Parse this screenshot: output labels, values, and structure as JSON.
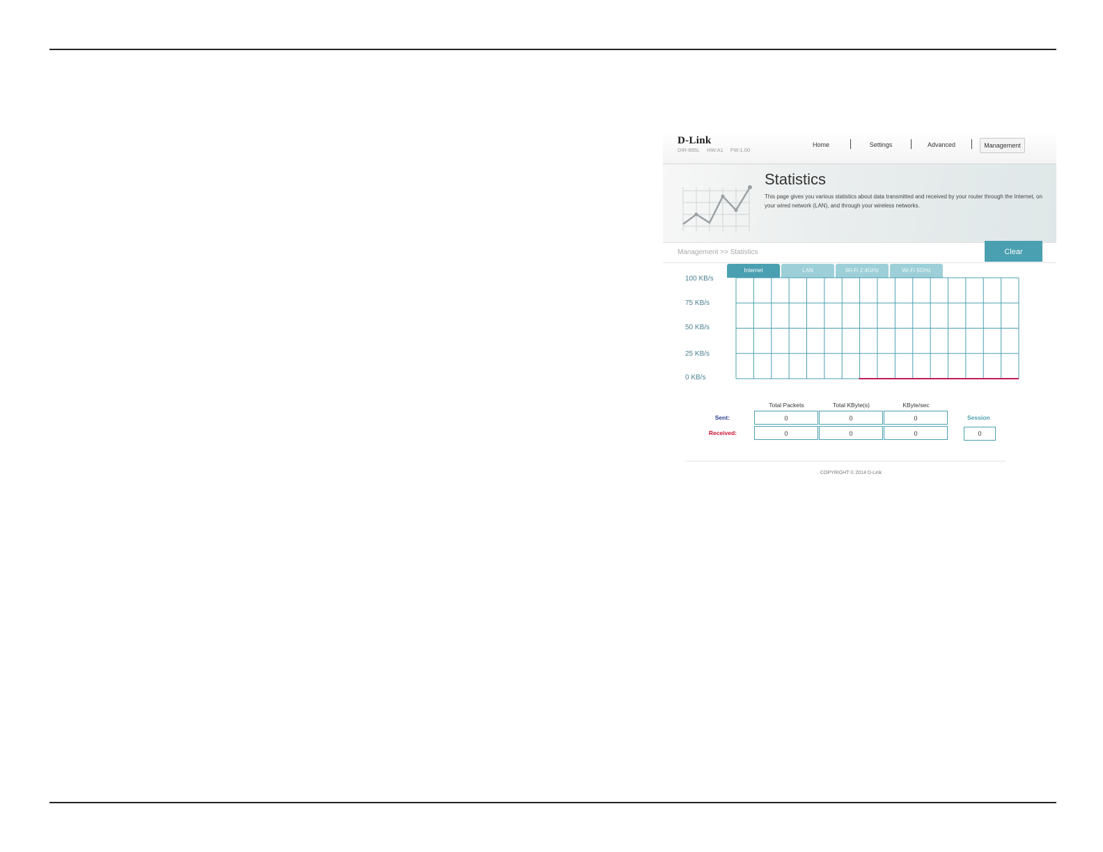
{
  "header": {
    "logo": "D-Link",
    "model": "DIR-885L",
    "hw": "HW:A1",
    "fw": "FW:1.00",
    "nav": [
      "Home",
      "Settings",
      "Advanced",
      "Management"
    ],
    "active_nav": "Management"
  },
  "banner": {
    "icon": "chart-graphic-icon",
    "title": "Statistics",
    "description": "This page gives you various statistics about data transmitted and received by your router through the Internet, on your wired network (LAN), and through your wireless networks."
  },
  "breadcrumb": "Management >> Statistics",
  "clear_label": "Clear",
  "tabs": [
    "Internet",
    "LAN",
    "Wi-Fi 2.4GHz",
    "Wi-Fi 5GHz"
  ],
  "active_tab": "Internet",
  "chart_data": {
    "type": "line",
    "y_ticks": [
      "100 KB/s",
      "75 KB/s",
      "50 KB/s",
      "25 KB/s",
      "0 KB/s"
    ],
    "ylim": [
      0,
      100
    ],
    "grid": true,
    "series": [
      {
        "color": "#c2185b",
        "values": [
          0,
          0,
          0,
          0,
          0,
          0,
          0,
          0,
          0,
          0
        ]
      }
    ]
  },
  "stats": {
    "columns": [
      "Total Packets",
      "Total KByte(s)",
      "KByte/sec"
    ],
    "sent_label": "Sent:",
    "received_label": "Received:",
    "sent": [
      "0",
      "0",
      "0"
    ],
    "received": [
      "0",
      "0",
      "0"
    ],
    "session_label": "Session",
    "session_value": "0"
  },
  "colors": {
    "accent": "#4a9fb0",
    "sent": "#2a3f8f",
    "received": "#c8102e",
    "graph_line": "#c2185b"
  },
  "footer": "COPYRIGHT © 2014 D-Link"
}
